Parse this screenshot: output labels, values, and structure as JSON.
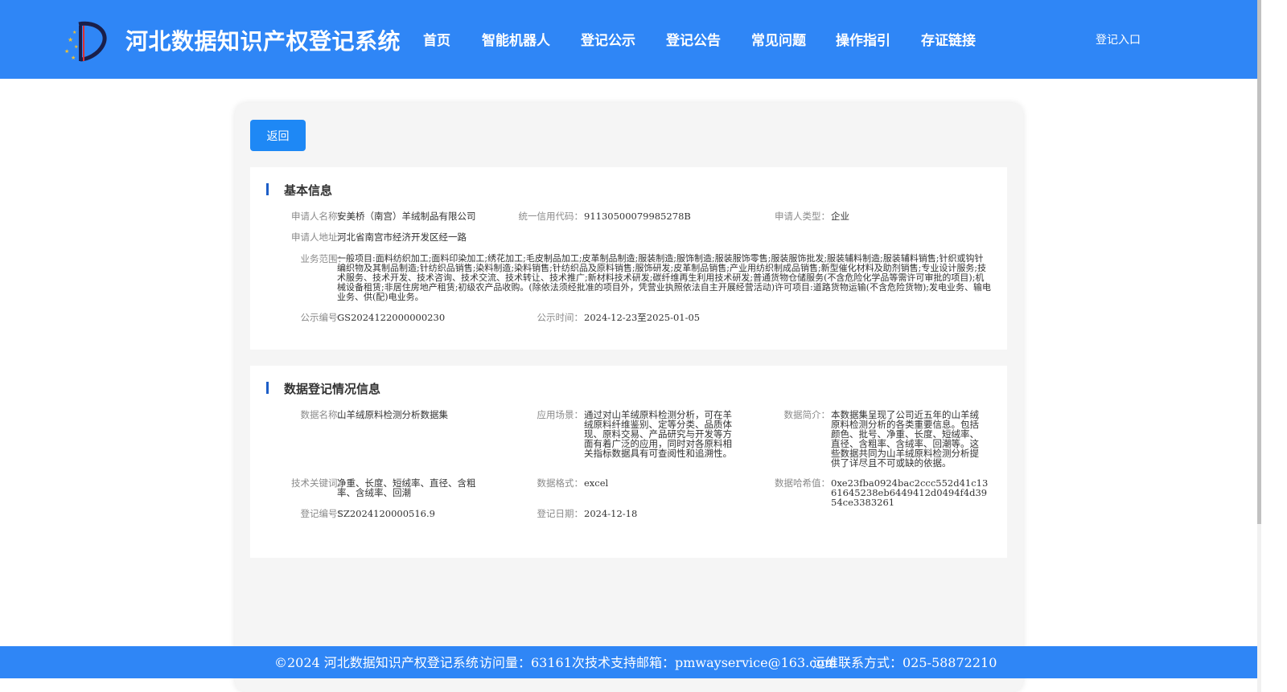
{
  "header": {
    "site_title": "河北数据知识产权登记系统",
    "nav": [
      "首页",
      "智能机器人",
      "登记公示",
      "登记公告",
      "常见问题",
      "操作指引",
      "存证链接"
    ],
    "login": "登记入口"
  },
  "colors": {
    "brand": "#2f86f6",
    "button": "#1e88f5",
    "section_bar": "#1d5ec7"
  },
  "back_button": "返回",
  "basic_info": {
    "title": "基本信息",
    "applicant_name_label": "申请人名称：",
    "applicant_name": "安美桥（南宫）羊绒制品有限公司",
    "credit_code_label": "统一信用代码：",
    "credit_code": "91130500079985278B",
    "applicant_type_label": "申请人类型：",
    "applicant_type": "企业",
    "address_label": "申请人地址：",
    "address": "河北省南宫市经济开发区经一路",
    "scope_label": "业务范围：",
    "scope": "一般项目:面料纺织加工;面料印染加工;绣花加工;毛皮制品加工;皮革制品制造;服装制造;服饰制造;服装服饰零售;服装服饰批发;服装辅料制造;服装辅料销售;针织或钩针编织物及其制品制造;针纺织品销售;染料制造;染料销售;针纺织品及原料销售;服饰研发;皮革制品销售;产业用纺织制成品销售;新型催化材料及助剂销售;专业设计服务;技术服务、技术开发、技术咨询、技术交流、技术转让、技术推广;新材料技术研发;碳纤维再生利用技术研发;普通货物仓储服务(不含危险化学品等需许可审批的项目);机械设备租赁;非居住房地产租赁;初级农产品收购。(除依法须经批准的项目外，凭营业执照依法自主开展经营活动)许可项目:道路货物运输(不含危险货物);发电业务、输电业务、供(配)电业务。",
    "pub_no_label": "公示编号：",
    "pub_no": "GS2024122000000230",
    "pub_time_label": "公示时间：",
    "pub_time": "2024-12-23至2025-01-05"
  },
  "data_info": {
    "title": "数据登记情况信息",
    "name_label": "数据名称：",
    "name": "山羊绒原料检测分析数据集",
    "scenario_label": "应用场景：",
    "scenario": "通过对山羊绒原料检测分析，可在羊绒原料纤维鉴别、定等分类、品质体现、原料交易、产品研究与开发等方面有着广泛的应用，同时对各原料相关指标数据具有可查阅性和追溯性。",
    "intro_label": "数据简介：",
    "intro": "本数据集呈现了公司近五年的山羊绒原料检测分析的各类重要信息。包括颜色、批号、净重、长度、短绒率、直径、含粗率、含绒率、回潮等。这些数据共同为山羊绒原料检测分析提供了详尽且不可或缺的依据。",
    "keywords_label": "技术关键词：",
    "keywords": "净重、长度、短绒率、直径、含粗率、含绒率、回潮",
    "format_label": "数据格式：",
    "format": "excel",
    "hash_label": "数据哈希值：",
    "hash": "0xe23fba0924bac2ccc552d41c1361645238eb6449412d0494f4d3954ce3383261",
    "reg_no_label": "登记编号：",
    "reg_no": "SZ2024120000516.9",
    "reg_date_label": "登记日期：",
    "reg_date": "2024-12-18"
  },
  "footer": {
    "copyright": "©2024 河北数据知识产权登记系统",
    "visits": "访问量：63161次",
    "email": "技术支持邮箱：pmwayservice@163.com",
    "phone": "运维联系方式：025-58872210"
  }
}
